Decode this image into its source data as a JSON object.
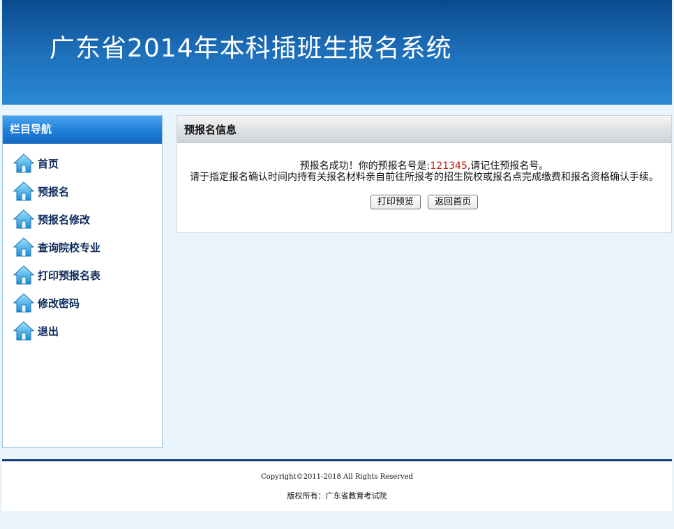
{
  "header": {
    "title": "广东省2014年本科插班生报名系统"
  },
  "sidebar": {
    "title": "栏目导航",
    "items": [
      {
        "label": "首页",
        "icon": "home-icon"
      },
      {
        "label": "预报名",
        "icon": "home-icon"
      },
      {
        "label": "预报名修改",
        "icon": "home-icon"
      },
      {
        "label": "查询院校专业",
        "icon": "home-icon"
      },
      {
        "label": "打印预报名表",
        "icon": "home-icon"
      },
      {
        "label": "修改密码",
        "icon": "home-icon"
      },
      {
        "label": "退出",
        "icon": "home-icon"
      }
    ]
  },
  "main": {
    "title": "预报名信息",
    "message": {
      "prefix": "预报名成功！你的预报名号是:",
      "number": "121345",
      "suffix": ",请记住预报名号。",
      "instruction": "请于指定报名确认时间内持有关报名材料亲自前往所报考的招生院校或报名点完成缴费和报名资格确认手续。"
    },
    "buttons": {
      "print": "打印预览",
      "back": "返回首页"
    }
  },
  "footer": {
    "copyright": "Copyright©2011-2018 All Rights Reserved",
    "owner": "版权所有：广东省教育考试院"
  }
}
